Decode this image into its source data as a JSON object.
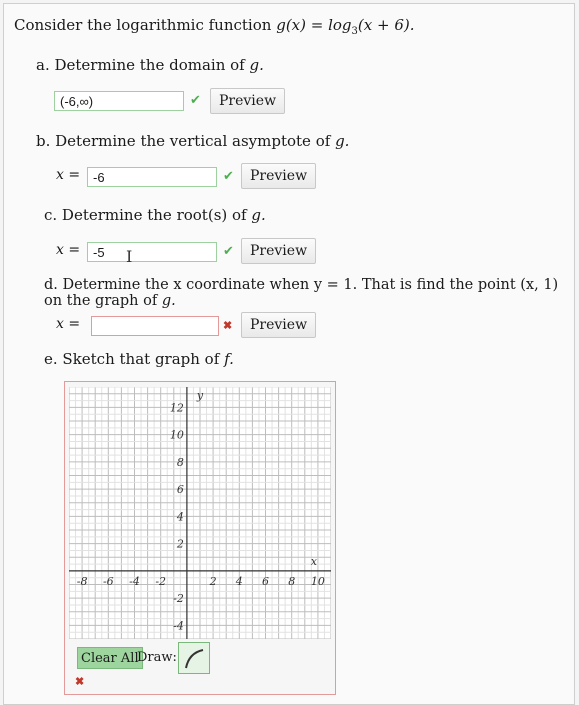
{
  "prompt": {
    "intro": "Consider the logarithmic function",
    "function": "g(x) = log",
    "base": "3",
    "arg": "(x + 6)."
  },
  "parts": {
    "a": {
      "text": "a. Determine the domain of",
      "var": "g.",
      "value": "(-6,∞)",
      "preview": "Preview"
    },
    "b": {
      "text": "b. Determine the vertical asymptote of",
      "var": "g.",
      "lhs": "x =",
      "value": "-6",
      "preview": "Preview"
    },
    "c": {
      "text": "c. Determine the root(s) of",
      "var": "g.",
      "lhs": "x =",
      "value": "-5",
      "preview": "Preview"
    },
    "d": {
      "text": "d. Determine the x coordinate when y = 1. That is find the point (x, 1) on the graph of",
      "var": "g.",
      "lhs": "x =",
      "value": "",
      "preview": "Preview"
    },
    "e": {
      "text": "e. Sketch that graph of",
      "var": "f."
    }
  },
  "graph": {
    "x_ticks": [
      "-8",
      "-6",
      "-4",
      "-2",
      "2",
      "4",
      "6",
      "8",
      "10"
    ],
    "y_ticks": [
      "12",
      "10",
      "8",
      "6",
      "4",
      "2",
      "-2",
      "-4"
    ],
    "x_label": "x",
    "y_label": "y",
    "clear_label": "Clear All",
    "draw_label": "Draw:"
  },
  "colors": {
    "correct": "#4caf50",
    "incorrect": "#c0392b",
    "button_green": "#9ed59e"
  }
}
